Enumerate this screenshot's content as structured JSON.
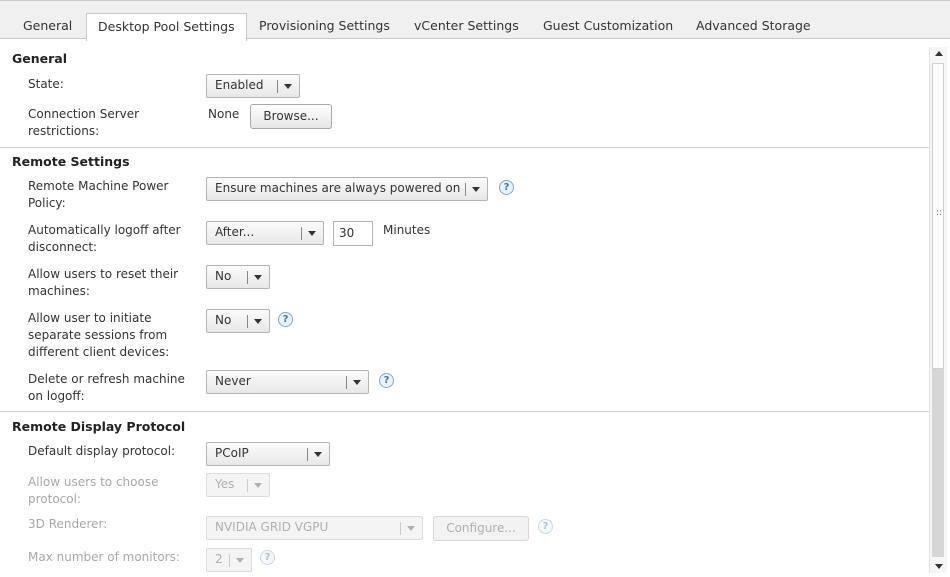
{
  "tabs": [
    {
      "label": "General"
    },
    {
      "label": "Desktop Pool Settings",
      "active": true
    },
    {
      "label": "Provisioning Settings"
    },
    {
      "label": "vCenter Settings"
    },
    {
      "label": "Guest Customization"
    },
    {
      "label": "Advanced Storage"
    }
  ],
  "general": {
    "title": "General",
    "state_label": "State:",
    "state_value": "Enabled",
    "conn_label_1": "Connection Server",
    "conn_label_2": "restrictions:",
    "conn_value": "None",
    "browse_label": "Browse..."
  },
  "remote": {
    "title": "Remote Settings",
    "power_label_1": "Remote Machine Power",
    "power_label_2": "Policy:",
    "power_value": "Ensure machines are always powered on",
    "logoff_label_1": "Automatically logoff after",
    "logoff_label_2": "disconnect:",
    "logoff_value": "After...",
    "logoff_minutes": "30",
    "logoff_unit": "Minutes",
    "reset_label_1": "Allow users to reset their",
    "reset_label_2": "machines:",
    "reset_value": "No",
    "sessions_label_1": "Allow user to initiate",
    "sessions_label_2": "separate sessions from",
    "sessions_label_3": "different client devices:",
    "sessions_value": "No",
    "delete_label_1": "Delete or refresh machine",
    "delete_label_2": "on logoff:",
    "delete_value": "Never"
  },
  "display": {
    "title": "Remote Display Protocol",
    "protocol_label": "Default display protocol:",
    "protocol_value": "PCoIP",
    "choose_label_1": "Allow users to choose",
    "choose_label_2": "protocol:",
    "choose_value": "Yes",
    "renderer_label": "3D Renderer:",
    "renderer_value": "NVIDIA GRID VGPU",
    "configure_label": "Configure...",
    "monitors_label": "Max number of monitors:",
    "monitors_value": "2"
  },
  "help_glyph": "?",
  "scroll_grip": "::",
  "icons": {
    "help": "help-circle-icon",
    "dropdown": "chevron-down-icon",
    "scroll_up": "arrow-up-icon",
    "scroll_down": "arrow-down-icon"
  }
}
